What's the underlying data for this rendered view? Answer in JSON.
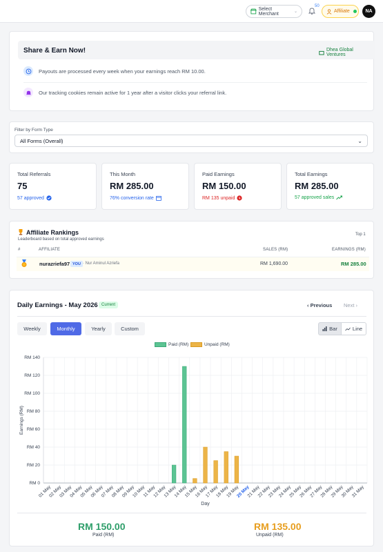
{
  "topbar": {
    "merchant_select": "Select Merchant",
    "notif_count": "50",
    "role_label": "Affiliate",
    "avatar_initials": "NA"
  },
  "share": {
    "title": "Share & Earn Now!",
    "merchant_name": "Dhea Global Ventures",
    "info": [
      "Payouts are processed every week when your earnings reach RM 10.00.",
      "Our tracking cookies remain active for 1 year after a visitor clicks your referral link."
    ]
  },
  "filter": {
    "label": "Filter by Form Type",
    "value": "All Forms (Overall)"
  },
  "stats": [
    {
      "label": "Total Referrals",
      "value": "75",
      "sub": "57 approved",
      "sub_color": "#2563eb",
      "icon": "check-circle-icon"
    },
    {
      "label": "This Month",
      "value": "RM 285.00",
      "sub": "76% conversion rate",
      "sub_color": "#2563eb",
      "icon": "calendar-icon"
    },
    {
      "label": "Paid Earnings",
      "value": "RM 150.00",
      "sub": "RM 135 unpaid",
      "sub_color": "#dc2626",
      "icon": "alert-circle-icon"
    },
    {
      "label": "Total Earnings",
      "value": "RM 285.00",
      "sub": "57 approved sales",
      "sub_color": "#16a34a",
      "icon": "trend-up-icon"
    }
  ],
  "rankings": {
    "title": "Affiliate Rankings",
    "subtitle": "Leaderboard based on total approved earnings",
    "top_label": "Top 1",
    "headers": {
      "rank": "#",
      "affiliate": "AFFILIATE",
      "sales": "SALES (RM)",
      "earnings": "EARNINGS (RM)"
    },
    "rows": [
      {
        "username": "nurazriefa97",
        "you_badge": "YOU",
        "full_name": "· Nur Aminul Azriefa",
        "sales": "RM 1,690.00",
        "earnings": "RM 285.00"
      }
    ]
  },
  "daily": {
    "title": "Daily Earnings -  May 2026",
    "badge": "Current",
    "prev_label": "Previous",
    "next_label": "Next",
    "tabs": [
      "Weekly",
      "Monthly",
      "Yearly",
      "Custom"
    ],
    "active_tab": "Monthly",
    "modes": [
      "Bar",
      "Line"
    ],
    "active_mode": "Bar",
    "totals": {
      "paid_value": "RM 150.00",
      "paid_label": "Paid (RM)",
      "unpaid_value": "RM 135.00",
      "unpaid_label": "Unpaid (RM)"
    }
  },
  "colors": {
    "paid": "#5cc493",
    "unpaid": "#ecb447",
    "accent": "#4f6ae6"
  },
  "chart_data": {
    "type": "bar",
    "xlabel": "Day",
    "ylabel": "Earnings (RM)",
    "ylim": [
      0,
      140
    ],
    "ytick_step": 20,
    "highlight_category": "20 May",
    "grid": true,
    "legend_position": "top-center",
    "categories": [
      "01 May",
      "02 May",
      "03 May",
      "04 May",
      "05 May",
      "06 May",
      "07 May",
      "08 May",
      "09 May",
      "10 May",
      "11 May",
      "12 May",
      "13 May",
      "14 May",
      "15 May",
      "16 May",
      "17 May",
      "18 May",
      "19 May",
      "20 May",
      "21 May",
      "22 May",
      "23 May",
      "24 May",
      "25 May",
      "26 May",
      "27 May",
      "28 May",
      "29 May",
      "30 May",
      "31 May"
    ],
    "series": [
      {
        "name": "Paid (RM)",
        "values": [
          0,
          0,
          0,
          0,
          0,
          0,
          0,
          0,
          0,
          0,
          0,
          0,
          20,
          130,
          0,
          0,
          0,
          0,
          0,
          0,
          0,
          0,
          0,
          0,
          0,
          0,
          0,
          0,
          0,
          0,
          0
        ]
      },
      {
        "name": "Unpaid (RM)",
        "values": [
          0,
          0,
          0,
          0,
          0,
          0,
          0,
          0,
          0,
          0,
          0,
          0,
          0,
          0,
          5,
          40,
          25,
          35,
          30,
          0,
          0,
          0,
          0,
          0,
          0,
          0,
          0,
          0,
          0,
          0,
          0
        ]
      }
    ]
  }
}
